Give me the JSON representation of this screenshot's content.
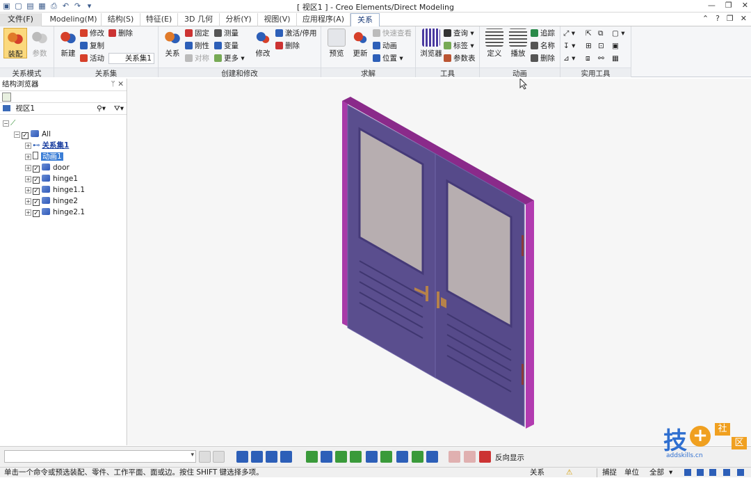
{
  "window": {
    "title": "[ 视区1 ] - Creo Elements/Direct Modeling"
  },
  "quick_access": {
    "undo": "↶",
    "redo": "↷",
    "more": "▾"
  },
  "tabs": [
    "文件(F)",
    "Modeling(M)",
    "结构(S)",
    "特征(E)",
    "3D 几何",
    "分析(Y)",
    "视图(V)",
    "应用程序(A)",
    "关系"
  ],
  "active_tab": "关系",
  "help": "?",
  "ribbon": {
    "groups": {
      "mode": "关系模式",
      "set": "关系集",
      "create": "创建和修改",
      "solve": "求解",
      "tools": "工具",
      "anim": "动画",
      "util": "实用工具"
    },
    "mode": {
      "assemble": "装配",
      "param": "参数"
    },
    "set": {
      "new": "新建",
      "modify": "修改",
      "delete": "删除",
      "copy": "复制",
      "active": "活动",
      "active_value": "关系集1"
    },
    "create": {
      "relation": "关系",
      "fix": "固定",
      "measure": "测量",
      "rigid": "刚性",
      "variable": "变量",
      "symmetric": "对称",
      "more": "更多",
      "modify": "修改",
      "activate": "激活/停用",
      "delete": "删除"
    },
    "solve": {
      "preview": "预览",
      "update": "更新",
      "quick_view": "快速查看",
      "animation": "动画",
      "position": "位置"
    },
    "tools": {
      "browser": "浏览器",
      "query": "查询",
      "tag": "标签",
      "param_table": "参数表"
    },
    "anim": {
      "define": "定义",
      "play": "播放",
      "track": "追踪",
      "name": "名称",
      "delete": "删除"
    }
  },
  "panel": {
    "title": "结构浏览器",
    "pin": "ᛘ",
    "close": "✕",
    "view": "视区1",
    "tree": [
      {
        "label": "All",
        "level": 1
      },
      {
        "label": "关系集1",
        "level": 2,
        "style": "link"
      },
      {
        "label": "动画1",
        "level": 2,
        "style": "selected"
      },
      {
        "label": "door",
        "level": 2
      },
      {
        "label": "hinge1",
        "level": 2
      },
      {
        "label": "hinge1.1",
        "level": 2
      },
      {
        "label": "hinge2",
        "level": 2
      },
      {
        "label": "hinge2.1",
        "level": 2
      }
    ]
  },
  "cmdbar": {
    "input_value": "",
    "reverse_display": "反向显示"
  },
  "status": {
    "message": "单击一个命令或预选装配、零件、工作平面、面或边。按住 SHIFT 键选择多项。",
    "relation": "关系",
    "snap": "捕捉",
    "unit": "单位",
    "filter": "全部"
  },
  "watermark": {
    "brand": "技",
    "site": "addskills.cn",
    "chars": [
      "社",
      "区"
    ]
  },
  "colors": {
    "door_body": "#5a4e8e",
    "frame": "#b23bb0",
    "glass": "#b7aeb0",
    "handle": "#b6824a",
    "active_tab": "#1d3d7a"
  }
}
